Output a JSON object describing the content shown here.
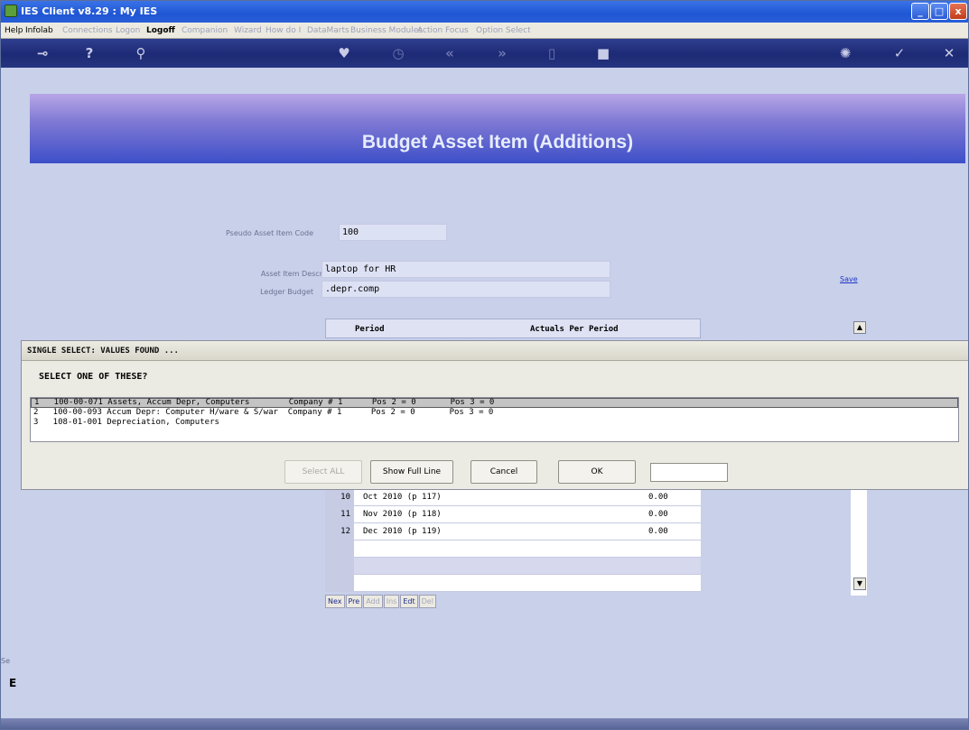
{
  "window": {
    "title": "IES Client v8.29 : My IES",
    "min": "_",
    "max": "□",
    "close": "x"
  },
  "menu": [
    {
      "label": "Help",
      "state": "on"
    },
    {
      "label": "Infolab",
      "state": "on"
    },
    {
      "label": "Connections",
      "state": "off"
    },
    {
      "label": "Logon",
      "state": "off"
    },
    {
      "label": "Logoff",
      "state": "bold"
    },
    {
      "label": "Companion",
      "state": "off"
    },
    {
      "label": "Wizard",
      "state": "off"
    },
    {
      "label": "How do I",
      "state": "off"
    },
    {
      "label": "DataMarts",
      "state": "off"
    },
    {
      "label": "Business Modules",
      "state": "off"
    },
    {
      "label": "Action Focus",
      "state": "off"
    },
    {
      "label": "Option Select",
      "state": "off"
    }
  ],
  "toolbar": {
    "icons": [
      "key-icon",
      "help-icon",
      "search-icon",
      "heart-icon",
      "clock-icon",
      "rewind-icon",
      "fast-forward-icon",
      "pages-icon",
      "stop-icon",
      "refresh-icon",
      "checkmark-icon",
      "close-icon"
    ]
  },
  "page": {
    "title": "Budget Asset Item (Additions)",
    "pseudo_code_label": "Pseudo Asset Item Code",
    "pseudo_code_value": "100",
    "descr_label": "Asset Item Descr",
    "descr_value": "laptop for HR",
    "ledger_label": "Ledger Budget",
    "ledger_value": ".depr.comp",
    "save_link": "Save",
    "grid_head_period": "Period",
    "grid_head_actuals": "Actuals Per Period",
    "grid_rows": [
      {
        "idx": "10",
        "period": "Oct 2010 (p 117)",
        "amount": "0.00"
      },
      {
        "idx": "11",
        "period": "Nov 2010 (p 118)",
        "amount": "0.00"
      },
      {
        "idx": "12",
        "period": "Dec 2010 (p 119)",
        "amount": "0.00"
      }
    ],
    "nav": [
      "Nex",
      "Pre",
      "Add",
      "Ins",
      "Edt",
      "Del"
    ],
    "scroll_up": "▲",
    "scroll_down": "▼",
    "side_stub": "Se",
    "side_stub2": "E"
  },
  "dialog": {
    "title": "SINGLE SELECT: VALUES FOUND ...",
    "prompt": "SELECT ONE OF THESE?",
    "items": [
      "1   100-00-071 Assets, Accum Depr, Computers        Company # 1      Pos 2 = 0       Pos 3 = 0",
      "2   100-00-093 Accum Depr: Computer H/ware & S/war  Company # 1      Pos 2 = 0       Pos 3 = 0",
      "3   108-01-001 Depreciation, Computers"
    ],
    "buttons": {
      "select_all": "Select ALL",
      "show_full_line": "Show Full Line",
      "cancel": "Cancel",
      "ok": "OK"
    }
  }
}
